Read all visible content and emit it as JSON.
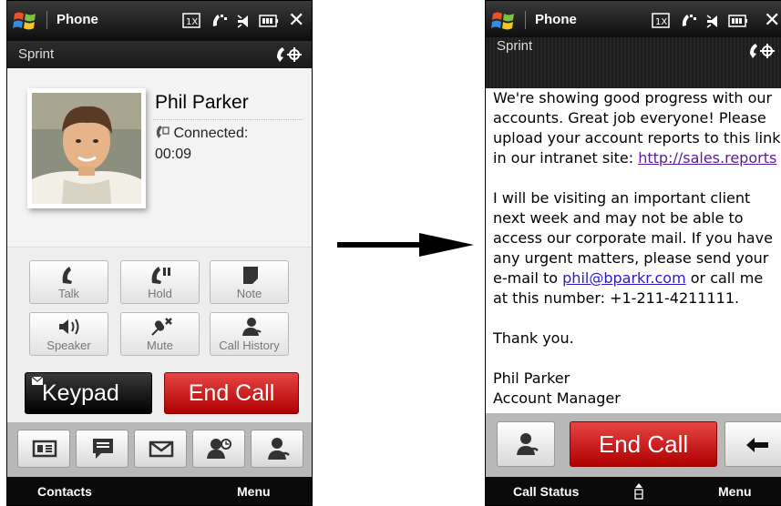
{
  "left_screen": {
    "title": "Phone",
    "carrier": "Sprint",
    "caller_name": "Phil Parker",
    "status": "Connected:",
    "duration": "00:09",
    "buttons": [
      {
        "label": "Talk",
        "icon": "phone-icon"
      },
      {
        "label": "Hold",
        "icon": "hold-icon"
      },
      {
        "label": "Note",
        "icon": "note-icon"
      },
      {
        "label": "Speaker",
        "icon": "speaker-icon"
      },
      {
        "label": "Mute",
        "icon": "mute-icon"
      },
      {
        "label": "Call History",
        "icon": "call-history-icon"
      }
    ],
    "keypad_label": "Keypad",
    "end_call_label": "End Call",
    "bottom_icons": [
      "contact-card-icon",
      "message-icon",
      "email-icon",
      "calendar-contact-icon",
      "contacts-icon"
    ],
    "softkeys": {
      "left": "Contacts",
      "right": "Menu"
    }
  },
  "right_screen": {
    "title": "Phone",
    "carrier": "Sprint",
    "email_lines_p1": [
      "We're showing good progress with our",
      "accounts. Great job everyone! Please",
      "upload your account reports to this link",
      "in our intranet site: "
    ],
    "email_link1": "http://sales.reports",
    "email_lines_p2": [
      "I will be visiting an important client",
      "next week and may not be able to",
      "access our corporate mail. If you have",
      "any urgent matters, please send your"
    ],
    "email_p2_line5_prefix": "e-mail to ",
    "email_link2": "phil@bparkr.com",
    "email_p2_line5_suffix": " or call me",
    "email_p2_line6": "at this number: +1-211-4211111.",
    "thanks": "Thank you.",
    "signature_name": "Phil Parker",
    "signature_title": "Account Manager",
    "end_call_label": "End Call",
    "softkeys": {
      "left": "Call Status",
      "right": "Menu"
    }
  },
  "colors": {
    "end_call": "#d21f1f",
    "title_bar": "#1a1a1a",
    "link": "#2a1acb"
  }
}
